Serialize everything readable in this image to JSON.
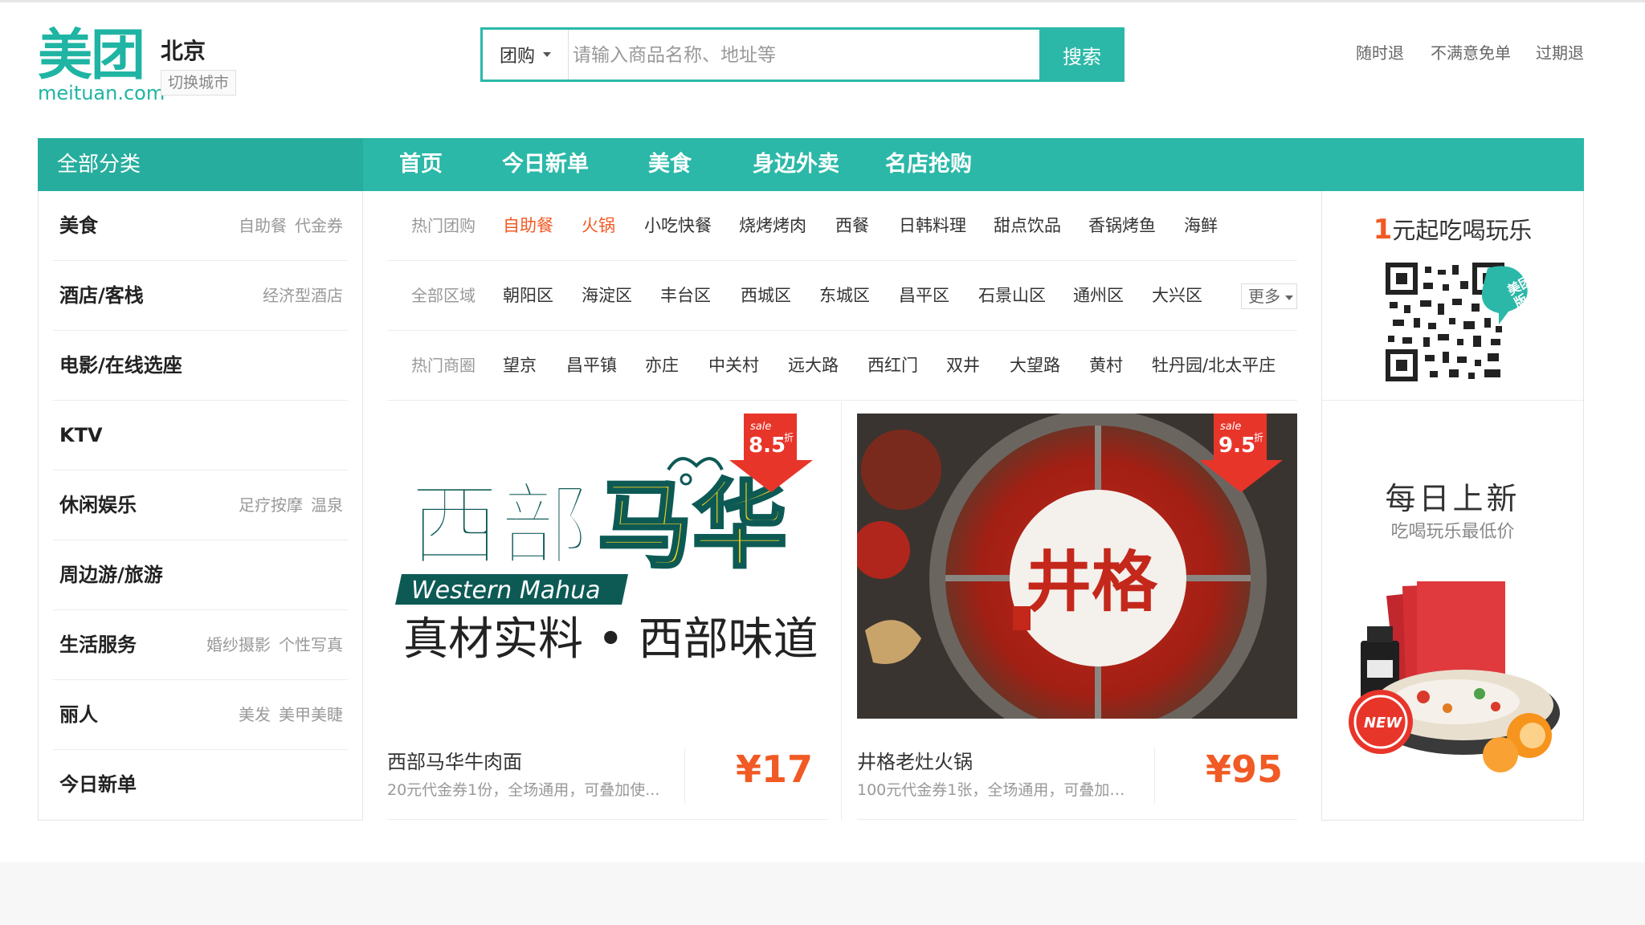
{
  "header": {
    "logo_text": "美团",
    "logo_domain": "meituan.com",
    "city": "北京",
    "switch_city": "切换城市",
    "search": {
      "type": "团购",
      "placeholder": "请输入商品名称、地址等",
      "button": "搜索"
    },
    "guarantees": [
      "随时退",
      "不满意免单",
      "过期退"
    ]
  },
  "nav": {
    "all_categories": "全部分类",
    "links": [
      "首页",
      "今日新单",
      "美食",
      "身边外卖",
      "名店抢购"
    ]
  },
  "sidebar": {
    "categories": [
      {
        "name": "美食",
        "subs": [
          "自助餐",
          "代金券"
        ]
      },
      {
        "name": "酒店/客栈",
        "subs": [
          "经济型酒店"
        ]
      },
      {
        "name": "电影/在线选座",
        "subs": []
      },
      {
        "name": "KTV",
        "subs": []
      },
      {
        "name": "休闲娱乐",
        "subs": [
          "足疗按摩",
          "温泉"
        ]
      },
      {
        "name": "周边游/旅游",
        "subs": []
      },
      {
        "name": "生活服务",
        "subs": [
          "婚纱摄影",
          "个性写真"
        ]
      },
      {
        "name": "丽人",
        "subs": [
          "美发",
          "美甲美睫"
        ]
      },
      {
        "name": "今日新单",
        "subs": []
      }
    ]
  },
  "filters": {
    "hot_deals": {
      "label": "热门团购",
      "items": [
        "自助餐",
        "火锅",
        "小吃快餐",
        "烧烤烤肉",
        "西餐",
        "日韩料理",
        "甜点饮品",
        "香锅烤鱼",
        "海鲜"
      ]
    },
    "areas": {
      "label": "全部区域",
      "items": [
        "朝阳区",
        "海淀区",
        "丰台区",
        "西城区",
        "东城区",
        "昌平区",
        "石景山区",
        "通州区",
        "大兴区"
      ],
      "more": "更多"
    },
    "circles": {
      "label": "热门商圈",
      "items": [
        "望京",
        "昌平镇",
        "亦庄",
        "中关村",
        "远大路",
        "西红门",
        "双井",
        "大望路",
        "黄村",
        "牡丹园/北太平庄"
      ]
    }
  },
  "deals": [
    {
      "title": "西部马华牛肉面",
      "desc": "20元代金券1份，全场通用，可叠加使...",
      "price": "¥17",
      "badge_sale": "sale",
      "badge_discount": "8.5",
      "badge_unit": "折",
      "brand_cn_1": "西部",
      "brand_cn_2": "马华",
      "brand_en": "Western Mahua",
      "slogan": "真材实料 • 西部味道"
    },
    {
      "title": "井格老灶火锅",
      "desc": "100元代金券1张，全场通用，可叠加使...",
      "price": "¥95",
      "badge_sale": "sale",
      "badge_discount": "9.5",
      "badge_unit": "折",
      "brand_cn": "井格"
    }
  ],
  "promo": {
    "qr_title_num": "1",
    "qr_title_rest": "元起吃喝玩乐",
    "qr_tag": "美团手机版",
    "daily_title": "每日上新",
    "daily_sub": "吃喝玩乐最低价",
    "new_badge": "NEW"
  },
  "colors": {
    "brand": "#2bb8a8",
    "price": "#f15a24",
    "badge": "#e8352a"
  }
}
